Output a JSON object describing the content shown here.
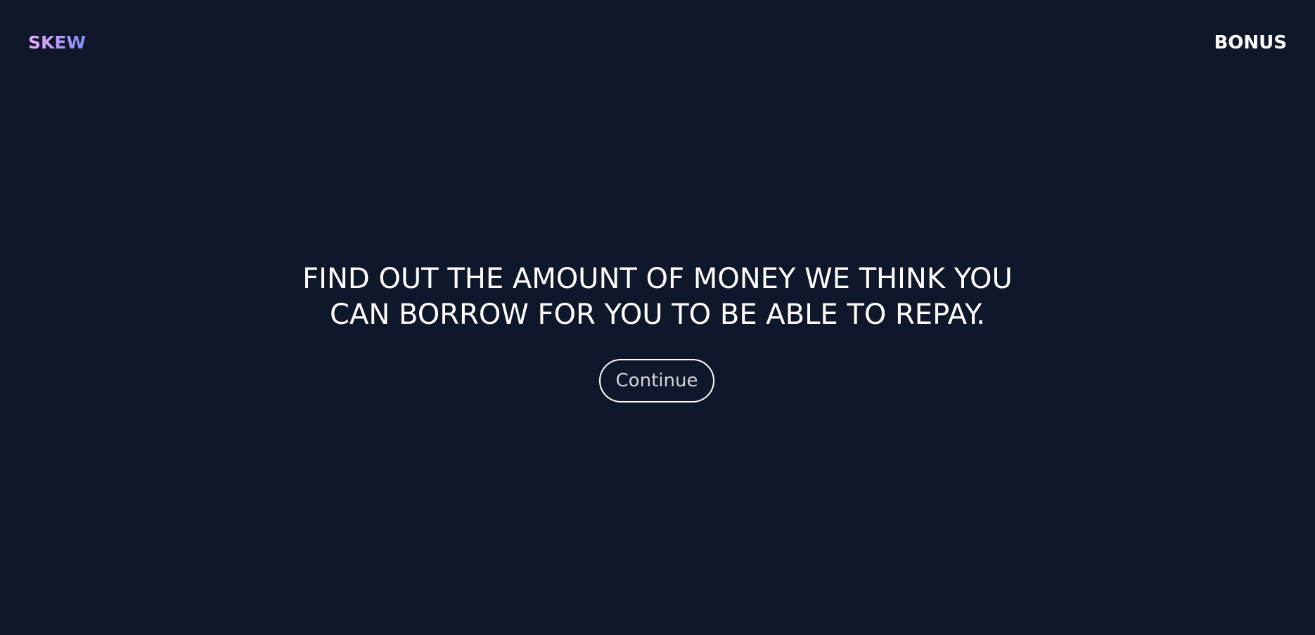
{
  "header": {
    "logo_text": "SKEW",
    "bonus_label": "BONUS"
  },
  "main": {
    "headline_line1": "FIND OUT THE AMOUNT OF MONEY WE THINK YOU",
    "headline_line2": "CAN BORROW FOR YOU TO BE ABLE TO REPAY.",
    "continue_label": "Continue"
  },
  "colors": {
    "background": "#0f172a",
    "logo_gradient_start": "#f0abfc",
    "logo_gradient_end": "#818cf8",
    "text": "#ffffff",
    "button_text": "#d1d5db"
  }
}
